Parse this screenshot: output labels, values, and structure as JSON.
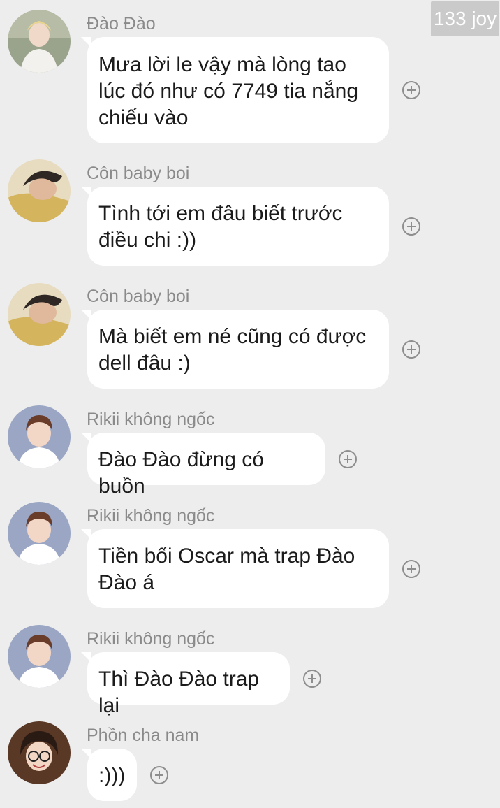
{
  "watermark": "133 joy",
  "messages": [
    {
      "sender": "Đào Đào",
      "text": "Mưa lời le vậy mà lòng tao lúc đó như có 7749 tia nắng chiếu vào",
      "avatar": "sender-1-avatar-icon"
    },
    {
      "sender": "Côn baby boi",
      "text": "Tình tới em đâu biết trước điều chi :))",
      "avatar": "sender-2-avatar-icon"
    },
    {
      "sender": "Côn baby boi",
      "text": "Mà biết em né cũng có được dell đâu :)",
      "avatar": "sender-2-avatar-icon"
    },
    {
      "sender": "Rikii không ngốc",
      "text": "Đào Đào đừng có buồn",
      "avatar": "sender-3-avatar-icon"
    },
    {
      "sender": "Rikii không ngốc",
      "text": "Tiền bối Oscar mà trap Đào Đào á",
      "avatar": "sender-3-avatar-icon"
    },
    {
      "sender": "Rikii không ngốc",
      "text": "Thì Đào Đào trap lại",
      "avatar": "sender-3-avatar-icon"
    },
    {
      "sender": "Phồn cha nam",
      "text": ":)))",
      "avatar": "sender-4-avatar-icon"
    }
  ]
}
